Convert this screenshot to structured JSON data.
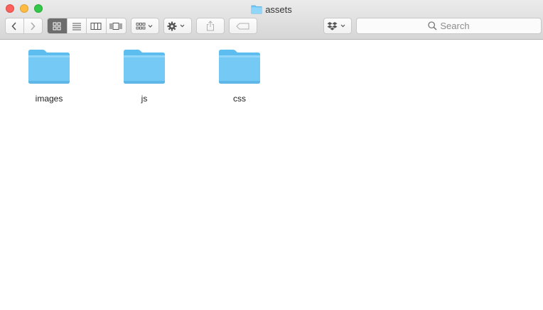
{
  "window": {
    "title": "assets",
    "title_icon": "folder-icon"
  },
  "toolbar": {
    "back_icon": "chevron-left-icon",
    "forward_icon": "chevron-right-icon",
    "view_modes": [
      {
        "name": "icon-view",
        "icon": "grid-icon",
        "active": true
      },
      {
        "name": "list-view",
        "icon": "list-icon",
        "active": false
      },
      {
        "name": "column-view",
        "icon": "columns-icon",
        "active": false
      },
      {
        "name": "cover-flow-view",
        "icon": "coverflow-icon",
        "active": false
      }
    ],
    "arrange_icon": "arrange-grid-icon",
    "action_icon": "gear-icon",
    "share_icon": "share-icon",
    "tags_icon": "tag-icon",
    "dropbox_icon": "dropbox-icon",
    "search": {
      "placeholder": "Search"
    }
  },
  "files": [
    {
      "name": "images",
      "type": "folder"
    },
    {
      "name": "js",
      "type": "folder"
    },
    {
      "name": "css",
      "type": "folder"
    }
  ],
  "colors": {
    "folder": "#6cc5f3",
    "folder_tab": "#7ccff6",
    "active_segment": "#6d6d6d"
  }
}
